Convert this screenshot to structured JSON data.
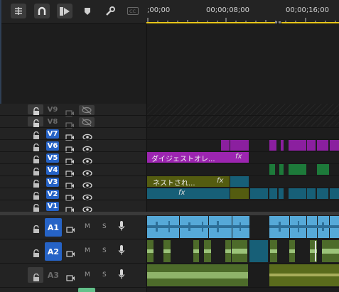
{
  "toolbar": {
    "icons": [
      "snap-icon",
      "linked-selection-icon",
      "add-marker-icon",
      "marker-icon",
      "wrench-icon",
      "captions-icon"
    ]
  },
  "ruler": {
    "timecodes": [
      ";00;00",
      "00;00;08;00",
      "00;00;16;00"
    ]
  },
  "tracks": {
    "video": [
      {
        "label": "V9",
        "active": false,
        "locked": true
      },
      {
        "label": "V8",
        "active": false,
        "locked": true
      },
      {
        "label": "V7",
        "active": true,
        "locked": false
      },
      {
        "label": "V6",
        "active": true,
        "locked": false
      },
      {
        "label": "V5",
        "active": true,
        "locked": false
      },
      {
        "label": "V4",
        "active": true,
        "locked": false
      },
      {
        "label": "V3",
        "active": true,
        "locked": false
      },
      {
        "label": "V2",
        "active": true,
        "locked": false
      },
      {
        "label": "V1",
        "active": true,
        "locked": false
      }
    ],
    "audio": [
      {
        "label": "A1",
        "active": true,
        "mute": "M",
        "solo": "S"
      },
      {
        "label": "A2",
        "active": true,
        "mute": "M",
        "solo": "S"
      },
      {
        "label": "A3",
        "active": false,
        "mute": "M",
        "solo": "S"
      }
    ]
  },
  "clips": {
    "v5_title": "ダイジェストオレ...",
    "v3_title": "ネストされ...",
    "fx": "fx"
  },
  "colors": {
    "accent": "#2663c6",
    "purple_clip": "#8b1f9f",
    "title_clip": "#9c25b0",
    "green_clip": "#1d7a3a",
    "olive_clip": "#545c10",
    "teal_clip": "#175f77",
    "audio_blue": "#56a9d8",
    "audio_green": "#4d6b2a",
    "ruler_yellow": "#e8c61a"
  }
}
